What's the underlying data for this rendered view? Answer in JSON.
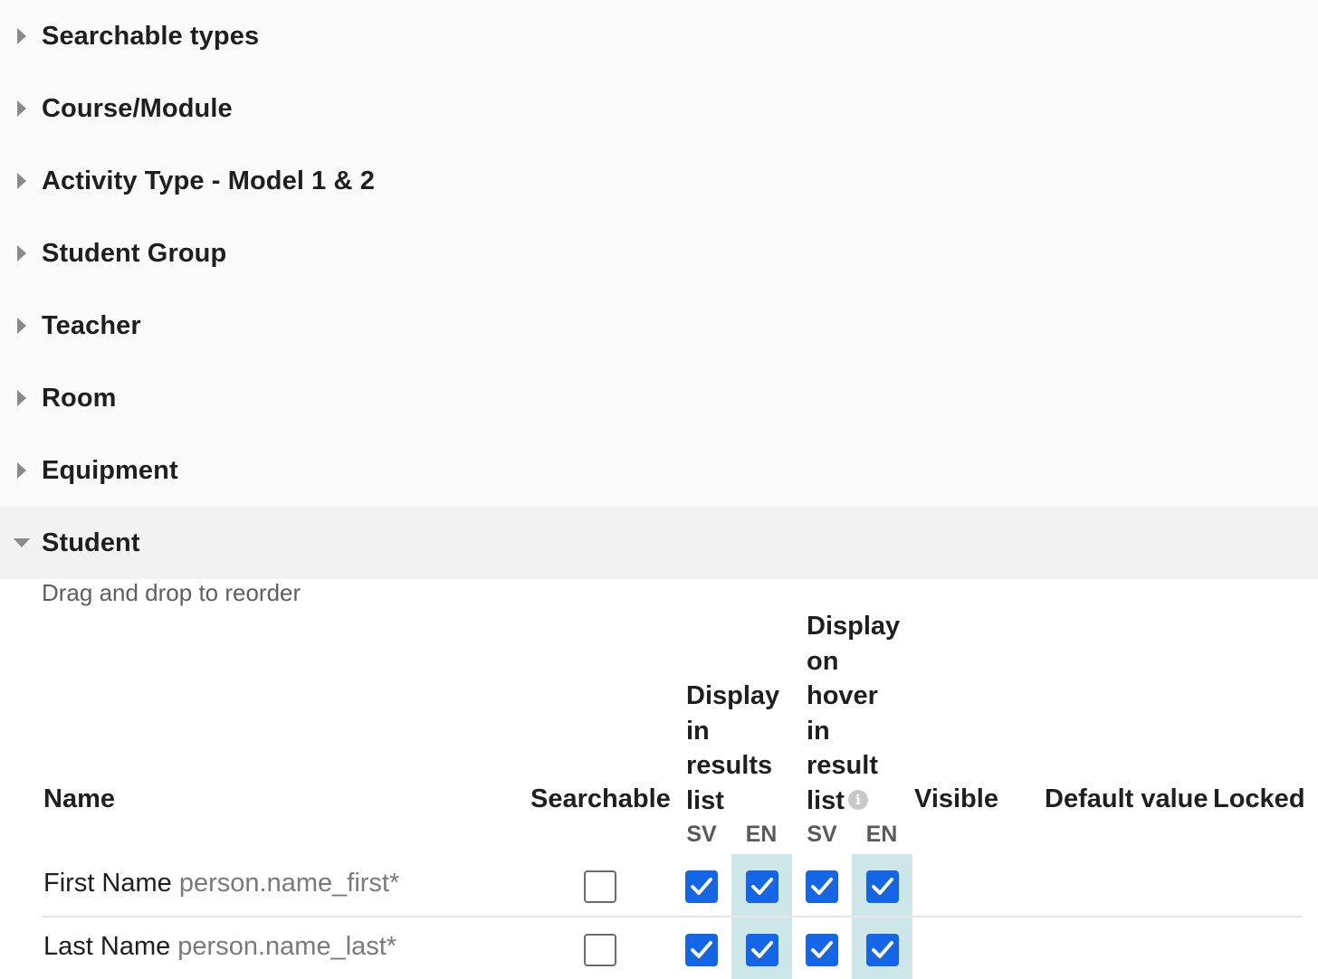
{
  "accordion": {
    "items": [
      {
        "label": "Searchable types"
      },
      {
        "label": "Course/Module"
      },
      {
        "label": "Activity Type - Model 1 & 2"
      },
      {
        "label": "Student Group"
      },
      {
        "label": "Teacher"
      },
      {
        "label": "Room"
      },
      {
        "label": "Equipment"
      }
    ],
    "open_item": {
      "label": "Student"
    }
  },
  "panel": {
    "hint": "Drag and drop to reorder",
    "columns": {
      "name": "Name",
      "searchable": "Searchable",
      "display_results": [
        "Display",
        "in",
        "results",
        "list"
      ],
      "display_hover": [
        "Display",
        "on",
        "hover",
        "in",
        "result",
        "list"
      ],
      "info_icon": "info-icon",
      "visible": "Visible",
      "default_value": "Default value",
      "locked": "Locked",
      "lang_sv": "SV",
      "lang_en": "EN"
    },
    "rows": [
      {
        "name": "First Name",
        "key": "person.name_first*",
        "searchable": false,
        "results_sv": true,
        "results_en": true,
        "hover_sv": true,
        "hover_en": true
      },
      {
        "name": "Last Name",
        "key": "person.name_last*",
        "searchable": false,
        "results_sv": true,
        "results_en": true,
        "hover_sv": true,
        "hover_en": true
      }
    ]
  },
  "colors": {
    "checkbox_checked": "#1466e6",
    "en_column_shade": "#cde6e8",
    "accordion_bg": "#fafafa",
    "open_header_bg": "#f2f2f2"
  }
}
